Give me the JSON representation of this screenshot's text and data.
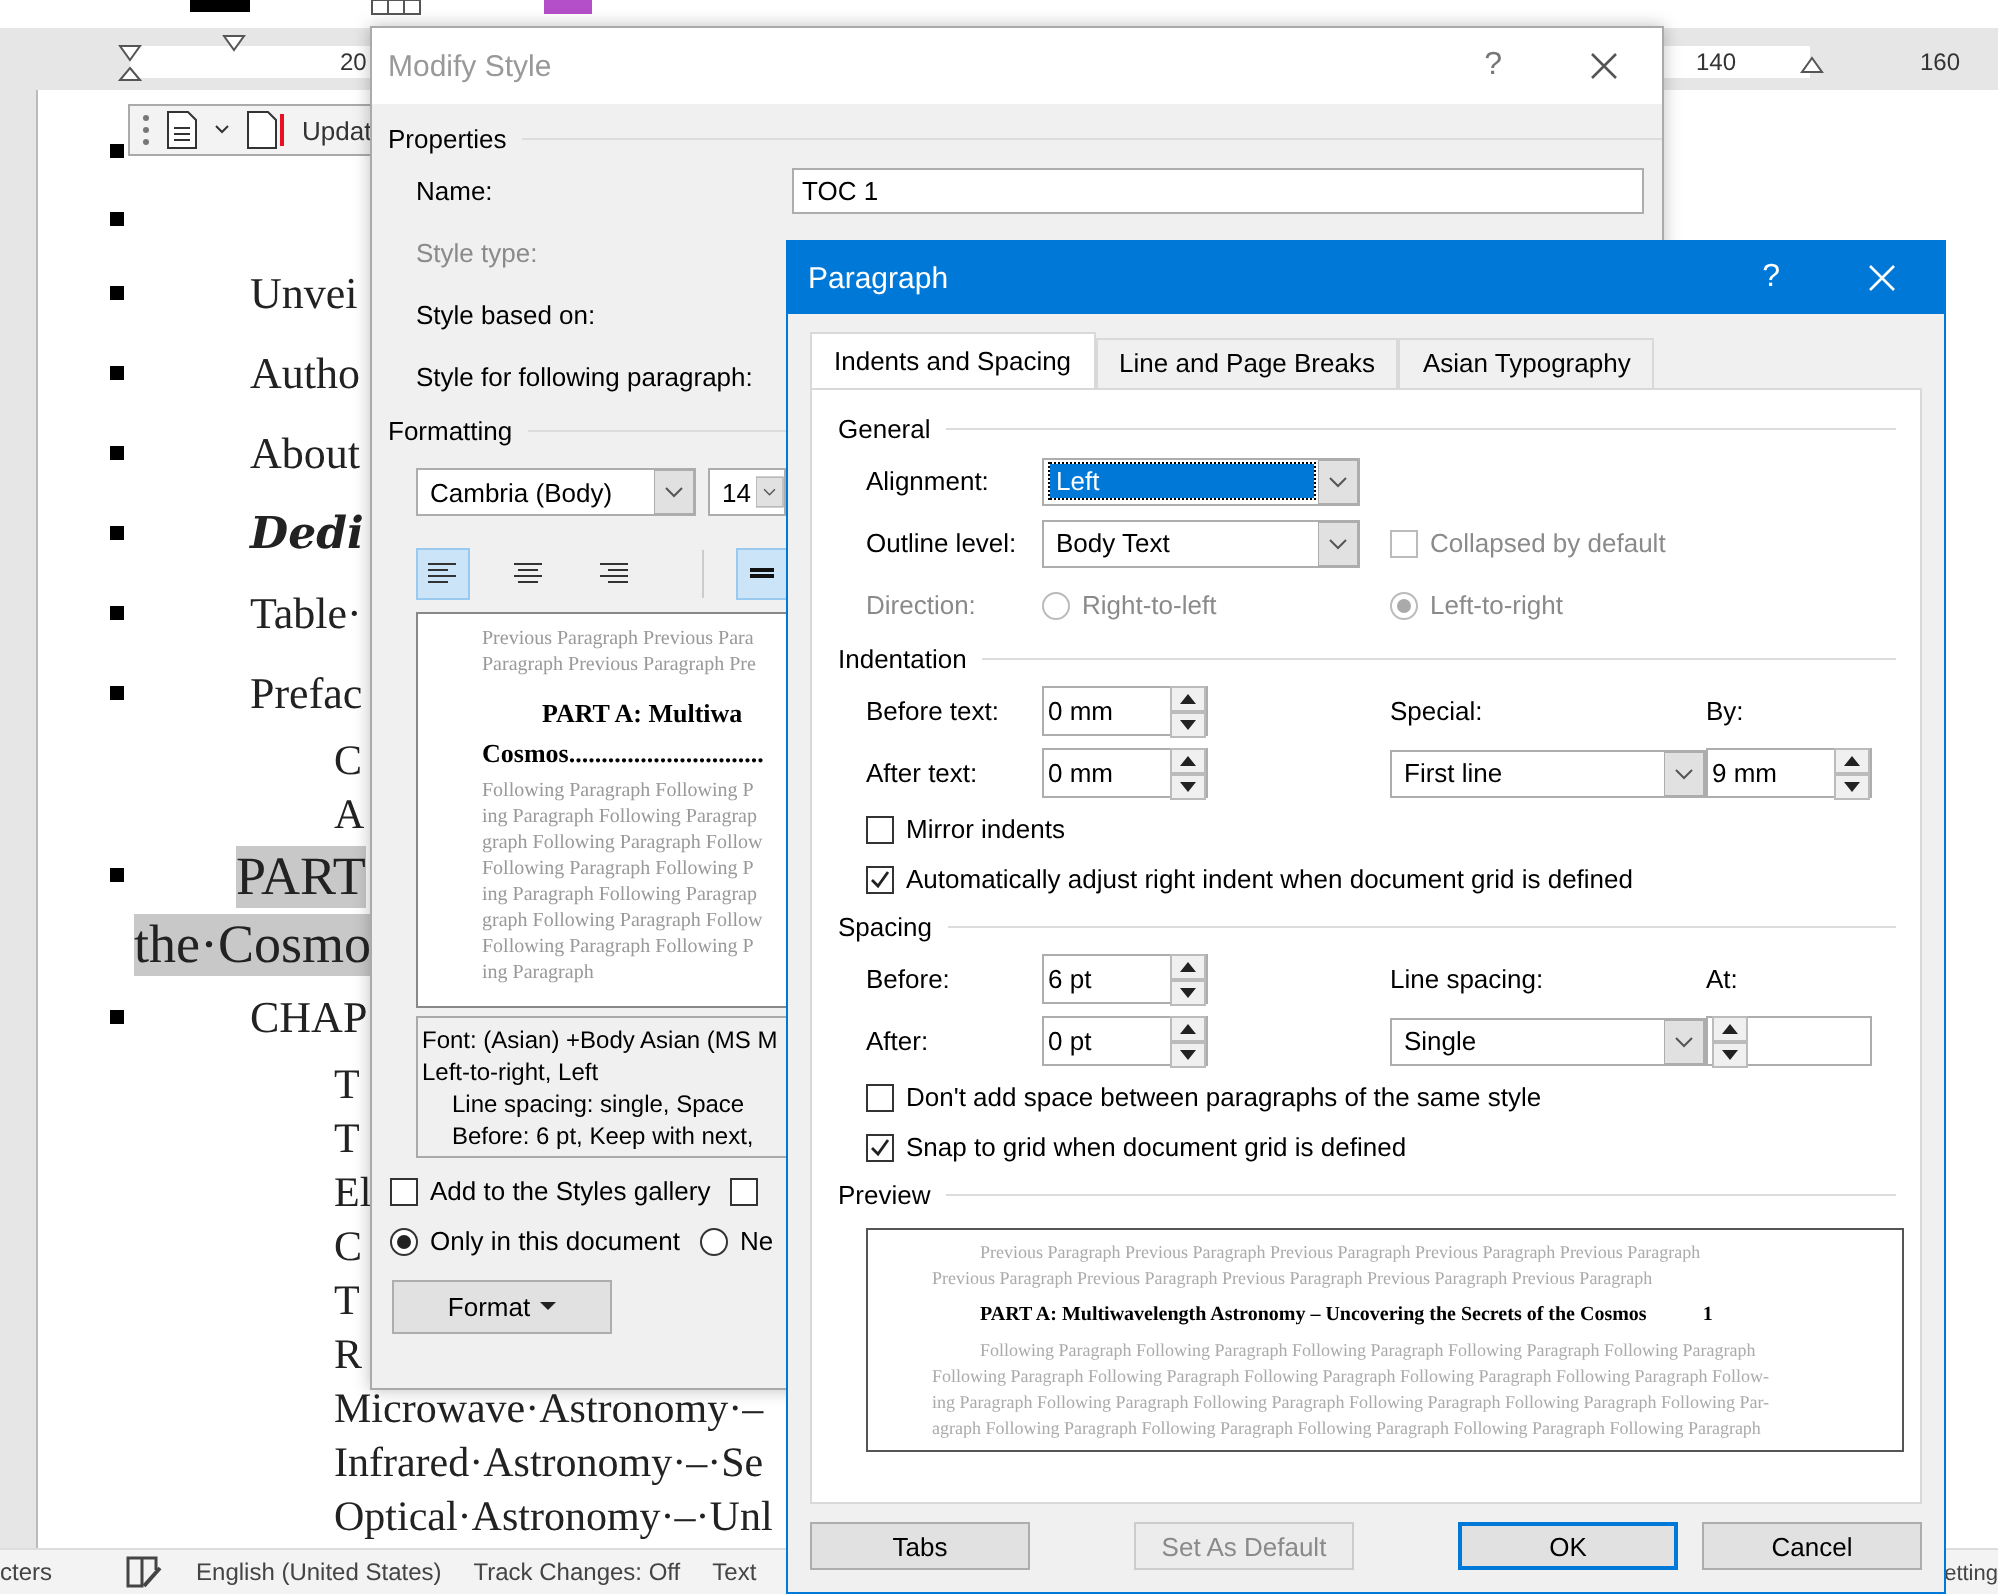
{
  "ruler": {
    "labels": [
      "20",
      "140",
      "160"
    ]
  },
  "mini_toolbar": {
    "button": "Updat"
  },
  "document": {
    "lines": [
      {
        "kind": "blank",
        "bullet": true,
        "highlighted": false
      },
      {
        "kind": "blank",
        "bullet": true,
        "highlighted": false
      },
      {
        "kind": "entry",
        "bullet": true,
        "text": "Unvei",
        "highlighted": false
      },
      {
        "kind": "entry",
        "bullet": true,
        "text": "Autho",
        "highlighted": false
      },
      {
        "kind": "entry",
        "bullet": true,
        "text": "About",
        "highlighted": false
      },
      {
        "kind": "fancy",
        "bullet": true,
        "text": "Dedi",
        "highlighted": false
      },
      {
        "kind": "entry",
        "bullet": true,
        "text": "Table·",
        "highlighted": false
      },
      {
        "kind": "entry",
        "bullet": true,
        "text": "Prefac",
        "highlighted": false
      },
      {
        "kind": "sub",
        "bullet": false,
        "text": "C",
        "highlighted": false
      },
      {
        "kind": "sub",
        "bullet": false,
        "text": "A",
        "highlighted": false
      },
      {
        "kind": "part",
        "bullet": true,
        "text": "PART",
        "highlighted": true
      },
      {
        "kind": "part-cont",
        "bullet": false,
        "text": "the·Cosmo",
        "highlighted": true
      },
      {
        "kind": "entry",
        "bullet": true,
        "text": "CHAP",
        "highlighted": false
      },
      {
        "kind": "sub",
        "bullet": false,
        "text": "T",
        "highlighted": false
      },
      {
        "kind": "sub",
        "bullet": false,
        "text": "T",
        "highlighted": false
      },
      {
        "kind": "sub",
        "bullet": false,
        "text": "El",
        "highlighted": false
      },
      {
        "kind": "sub",
        "bullet": false,
        "text": "C",
        "highlighted": false
      },
      {
        "kind": "sub",
        "bullet": false,
        "text": "T",
        "highlighted": false
      },
      {
        "kind": "sub",
        "bullet": false,
        "text": "R",
        "highlighted": false
      },
      {
        "kind": "sub",
        "bullet": false,
        "text": "Microwave·Astronomy·–",
        "highlighted": false
      },
      {
        "kind": "sub",
        "bullet": false,
        "text": "Infrared·Astronomy·–·Se",
        "highlighted": false
      },
      {
        "kind": "sub",
        "bullet": false,
        "text": "Optical·Astronomy·–·Unl",
        "highlighted": false
      }
    ]
  },
  "modify_style": {
    "title": "Modify Style",
    "help": "?",
    "properties": {
      "heading": "Properties",
      "fields": [
        {
          "label": "Name:",
          "value": "TOC 1",
          "disabled": false
        },
        {
          "label": "Style type:",
          "disabled": true
        },
        {
          "label": "Style based on:",
          "disabled": false
        },
        {
          "label": "Style for following paragraph:",
          "disabled": false
        }
      ]
    },
    "formatting": {
      "heading": "Formatting",
      "font": "Cambria (Body)",
      "size": "14",
      "buttons": [
        {
          "kind": "align-left",
          "selected": true
        },
        {
          "kind": "align-center",
          "selected": false
        },
        {
          "kind": "align-right",
          "selected": false
        },
        {
          "kind": "single-spacing",
          "selected": true
        }
      ]
    },
    "preview": {
      "previous": [
        "Previous Paragraph Previous Para",
        "Paragraph Previous Paragraph Pre"
      ],
      "sample": [
        "PART A:   Multiwa",
        "Cosmos.............................."
      ],
      "following": [
        "Following Paragraph Following P",
        "ing Paragraph Following Paragrap",
        "graph Following Paragraph Follow",
        "Following Paragraph Following P",
        "ing Paragraph Following Paragrap",
        "graph Following Paragraph Follow",
        "Following Paragraph Following P",
        "ing Paragraph"
      ]
    },
    "description": [
      "Font: (Asian) +Body Asian (MS M",
      "Left-to-right, Left",
      "Line spacing:  single, Space",
      "Before:  6 pt, Keep with next,"
    ],
    "checkboxes": [
      {
        "label": "Add to the Styles gallery",
        "checked": false
      },
      {
        "checked": false
      }
    ],
    "radios": [
      {
        "label": "Only in this document",
        "selected": true
      },
      {
        "label": "Ne",
        "selected": false
      }
    ],
    "format_button": "Format"
  },
  "paragraph": {
    "title": "Paragraph",
    "help": "?",
    "tabs": [
      {
        "label": "Indents and Spacing",
        "selected": true
      },
      {
        "label": "Line and Page Breaks",
        "selected": false
      },
      {
        "label": "Asian Typography",
        "selected": false
      }
    ],
    "general": {
      "heading": "General",
      "alignment": {
        "label": "Alignment:",
        "value": "Left",
        "highlighted": true
      },
      "outline_level": {
        "label": "Outline level:",
        "value": "Body Text",
        "highlighted": false
      },
      "collapsed": {
        "label": "Collapsed by default",
        "checked": false,
        "disabled": true
      },
      "direction": {
        "label": "Direction:",
        "disabled": true,
        "options": [
          {
            "label": "Right-to-left",
            "selected": false
          },
          {
            "label": "Left-to-right",
            "selected": true
          }
        ]
      }
    },
    "indentation": {
      "heading": "Indentation",
      "before_text": {
        "label": "Before text:",
        "value": "0 mm"
      },
      "after_text": {
        "label": "After text:",
        "value": "0 mm"
      },
      "special": {
        "label": "Special:",
        "value": "First line"
      },
      "by": {
        "label": "By:",
        "value": "9 mm"
      },
      "checkboxes": [
        {
          "label": "Mirror indents",
          "checked": false
        },
        {
          "label": "Automatically adjust right indent when document grid is defined",
          "checked": true
        }
      ]
    },
    "spacing": {
      "heading": "Spacing",
      "before": {
        "label": "Before:",
        "value": "6 pt"
      },
      "after": {
        "label": "After:",
        "value": "0 pt"
      },
      "line_spacing": {
        "label": "Line spacing:",
        "value": "Single"
      },
      "at": {
        "label": "At:"
      },
      "checkboxes": [
        {
          "label": "Don't add space between paragraphs of the same style",
          "checked": false
        },
        {
          "label": "Snap to grid when document grid is defined",
          "checked": true
        }
      ]
    },
    "preview": {
      "heading": "Preview",
      "previous": [
        "Previous Paragraph Previous Paragraph Previous Paragraph Previous Paragraph Previous Paragraph",
        "Previous Paragraph Previous Paragraph Previous Paragraph Previous Paragraph Previous Paragraph"
      ],
      "sample": "PART A:   Multiwavelength Astronomy – Uncovering the Secrets of the Cosmos",
      "page_number": "1",
      "following": [
        "Following Paragraph Following Paragraph Following Paragraph Following Paragraph Following Paragraph",
        "Following Paragraph Following Paragraph Following Paragraph Following Paragraph Following Paragraph Follow-",
        "ing Paragraph Following Paragraph Following Paragraph Following Paragraph Following Paragraph Following Par-",
        "agraph Following Paragraph Following Paragraph Following Paragraph Following Paragraph Following Paragraph"
      ]
    },
    "buttons": [
      {
        "label": "Tabs",
        "disabled": false,
        "default": false
      },
      {
        "label": "Set As Default",
        "disabled": true,
        "default": false
      },
      {
        "label": "OK",
        "disabled": false,
        "default": true
      },
      {
        "label": "Cancel",
        "disabled": false,
        "default": false
      }
    ]
  },
  "status_bar": {
    "items": [
      "cters",
      "English (United States)",
      "Track Changes: Off",
      "Text"
    ],
    "right": "etting"
  }
}
